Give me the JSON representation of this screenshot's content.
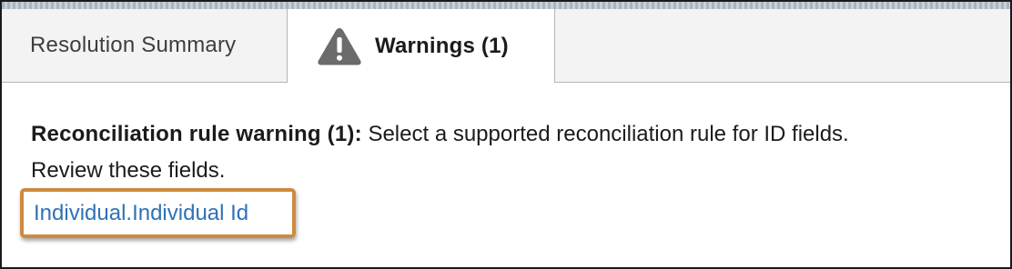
{
  "tabs": {
    "summary_label": "Resolution Summary",
    "warnings_label": "Warnings (1)",
    "warnings_icon": "warning-triangle-icon"
  },
  "warning": {
    "heading": "Reconciliation rule warning (1):",
    "text_line1": " Select a supported reconciliation rule for ID fields.",
    "text_line2": "Review these fields.",
    "fields": [
      {
        "label": "Individual.Individual Id"
      }
    ]
  },
  "colors": {
    "highlight_border": "#cf8a3f",
    "link": "#2f72b5",
    "icon": "#6b6b6b"
  }
}
